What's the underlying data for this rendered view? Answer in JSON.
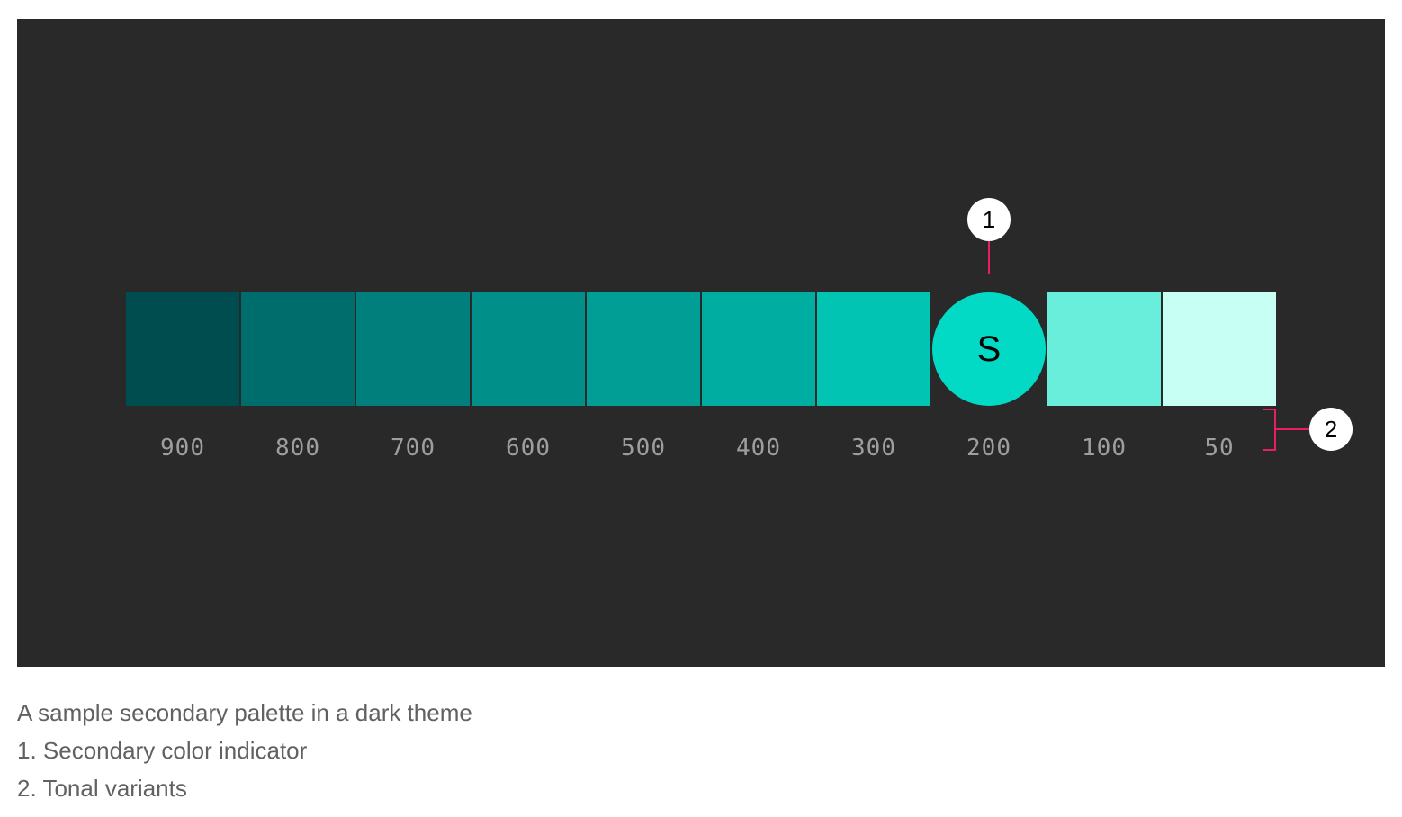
{
  "palette": {
    "tones": [
      {
        "label": "900",
        "color": "#004d4f"
      },
      {
        "label": "800",
        "color": "#006d6d"
      },
      {
        "label": "700",
        "color": "#007f7d"
      },
      {
        "label": "600",
        "color": "#008f89"
      },
      {
        "label": "500",
        "color": "#009e94"
      },
      {
        "label": "400",
        "color": "#00ada1"
      },
      {
        "label": "300",
        "color": "#02c4b2"
      },
      {
        "label": "200",
        "color": "#03dac6",
        "is_secondary": true,
        "indicator": "S"
      },
      {
        "label": "100",
        "color": "#69eedc"
      },
      {
        "label": "50",
        "color": "#c8fff4"
      }
    ]
  },
  "markers": {
    "one": "1",
    "two": "2"
  },
  "colors": {
    "background": "#292929",
    "callout": "#e91e63",
    "tone_label": "#9e9e9e"
  },
  "caption": {
    "title": "A sample secondary palette in a dark theme",
    "item1": "1. Secondary color indicator",
    "item2": "2. Tonal variants"
  }
}
